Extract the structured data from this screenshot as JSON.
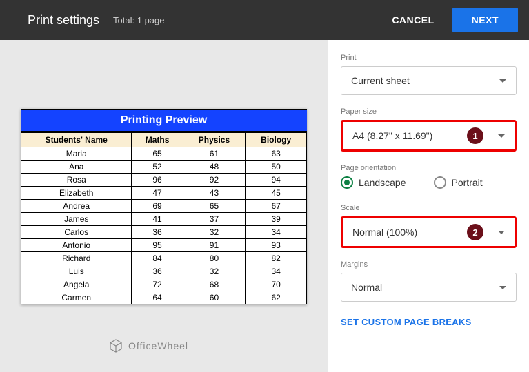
{
  "header": {
    "title": "Print settings",
    "total": "Total: 1 page",
    "cancel": "CANCEL",
    "next": "NEXT"
  },
  "preview": {
    "banner": "Printing Preview",
    "columns": [
      "Students' Name",
      "Maths",
      "Physics",
      "Biology"
    ],
    "rows": [
      [
        "Maria",
        "65",
        "61",
        "63"
      ],
      [
        "Ana",
        "52",
        "48",
        "50"
      ],
      [
        "Rosa",
        "96",
        "92",
        "94"
      ],
      [
        "Elizabeth",
        "47",
        "43",
        "45"
      ],
      [
        "Andrea",
        "69",
        "65",
        "67"
      ],
      [
        "James",
        "41",
        "37",
        "39"
      ],
      [
        "Carlos",
        "36",
        "32",
        "34"
      ],
      [
        "Antonio",
        "95",
        "91",
        "93"
      ],
      [
        "Richard",
        "84",
        "80",
        "82"
      ],
      [
        "Luis",
        "36",
        "32",
        "34"
      ],
      [
        "Angela",
        "72",
        "68",
        "70"
      ],
      [
        "Carmen",
        "64",
        "60",
        "62"
      ]
    ],
    "watermark": "OfficeWheel"
  },
  "sidebar": {
    "print_label": "Print",
    "print_value": "Current sheet",
    "paper_label": "Paper size",
    "paper_value": "A4 (8.27\" x 11.69\")",
    "orientation_label": "Page orientation",
    "landscape": "Landscape",
    "portrait": "Portrait",
    "scale_label": "Scale",
    "scale_value": "Normal (100%)",
    "margins_label": "Margins",
    "margins_value": "Normal",
    "custom_breaks": "SET CUSTOM PAGE BREAKS",
    "callout1": "1",
    "callout2": "2"
  }
}
